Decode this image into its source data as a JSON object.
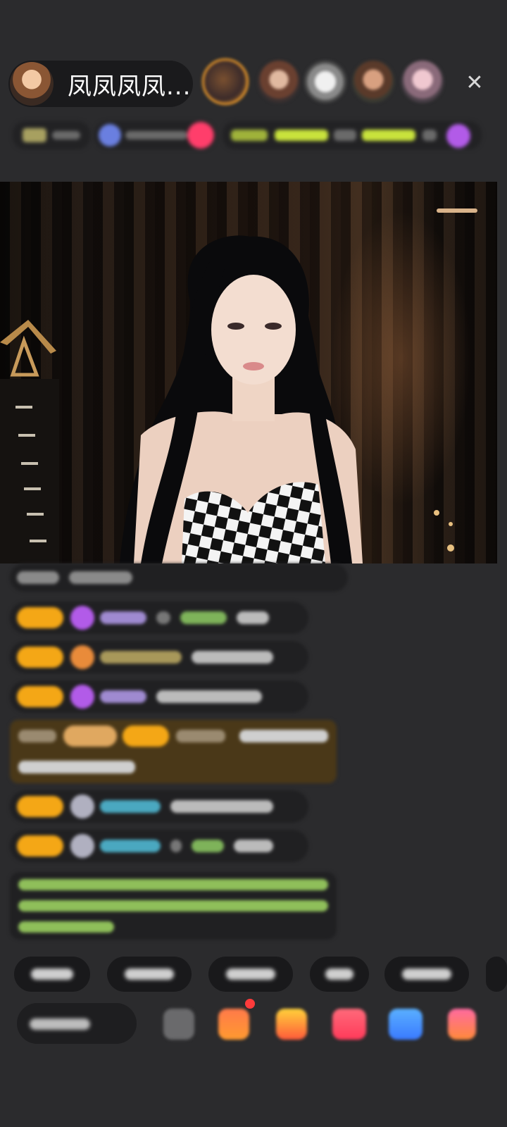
{
  "header": {
    "host_name": "凤凤凤凤...",
    "close_icon": "close-icon"
  },
  "colors": {
    "background": "#2b2b2d",
    "pill": "#1a1a1c",
    "level_badge": "#f4a716",
    "accent_pink": "#ff3e6b",
    "accent_lime": "#c8e23c"
  },
  "bottom": {
    "action_icons": [
      "keyboard-icon",
      "gift-box-icon",
      "treasure-icon",
      "heart-gift-icon",
      "game-controller-icon",
      "more-grid-icon"
    ]
  }
}
